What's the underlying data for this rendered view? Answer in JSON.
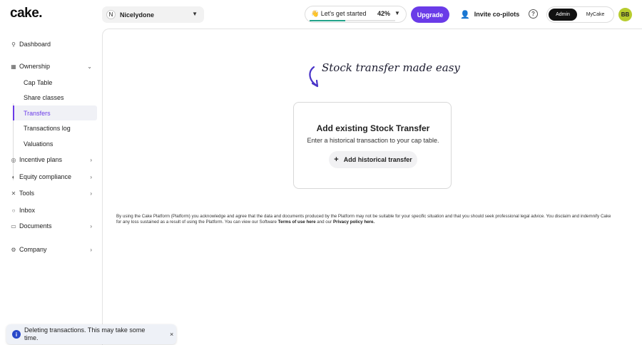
{
  "header": {
    "logo": "cake.",
    "company": {
      "initial": "N",
      "name": "Nicelydone"
    },
    "progress": {
      "label": "👋 Let's get started",
      "percent": "42%",
      "value": 0.42
    },
    "upgrade_label": "Upgrade",
    "invite_label": "Invite co-pilots",
    "help": "?",
    "roles": {
      "active": "Admin",
      "inactive": "MyCake"
    },
    "user_initials": "BB"
  },
  "sidebar": {
    "dashboard": "Dashboard",
    "ownership": "Ownership",
    "ownership_items": [
      "Cap Table",
      "Share classes",
      "Transfers",
      "Transactions log",
      "Valuations"
    ],
    "incentive": "Incentive plans",
    "equity": "Equity compliance",
    "tools": "Tools",
    "inbox": "Inbox",
    "documents": "Documents",
    "company": "Company"
  },
  "main": {
    "tagline": "Stock transfer made easy",
    "card_title": "Add existing Stock Transfer",
    "card_subtitle": "Enter a historical transaction to your cap table.",
    "card_button": "Add historical transfer",
    "disclaimer_text": "By using the Cake Platform (Platform) you acknowledge and agree that the data and documents produced by the Platform may not be suitable for your specific situation and that you should seek professional legal advice. You disclaim and indemnify Cake for any loss sustained as a result of using the Platform. You can view our Software",
    "terms_link": "Terms of use here",
    "and_our": "and our",
    "privacy_link": "Privacy policy here."
  },
  "toast": {
    "icon": "i",
    "message": "Deleting transactions. This may take some time.",
    "close": "×"
  },
  "colors": {
    "accent": "#6a3be8",
    "progress": "#22a38a",
    "avatar": "#b7cc2e"
  }
}
